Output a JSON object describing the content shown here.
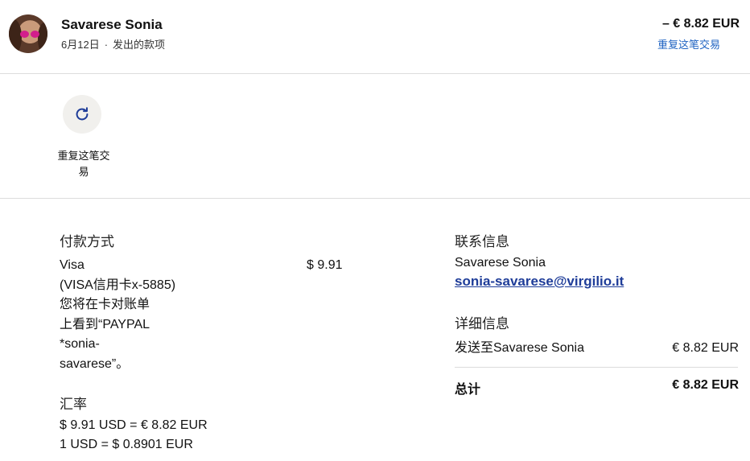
{
  "header": {
    "payee_name": "Savarese Sonia",
    "date": "6月12日",
    "separator": "·",
    "type": "发出的款项",
    "amount": "– € 8.82 EUR",
    "repeat_link": "重复这笔交易"
  },
  "actions": {
    "repeat_label": "重复这笔交易"
  },
  "payment_method": {
    "title": "付款方式",
    "description": "Visa\n(VISA信用卡x-5885)\n您将在卡对账单\n上看到“PAYPAL\n*sonia-\nsavarese”。",
    "amount": "$ 9.91"
  },
  "exchange_rate": {
    "title": "汇率",
    "line1": "$ 9.91 USD = € 8.82 EUR",
    "line2": "1 USD = $ 0.8901 EUR"
  },
  "contact": {
    "title": "联系信息",
    "name": "Savarese Sonia",
    "email": "sonia-savarese@virgilio.it"
  },
  "details": {
    "title": "详细信息",
    "sent_to": "发送至Savarese Sonia",
    "sent_amount": "€ 8.82 EUR",
    "total_label": "总计",
    "total_amount": "€ 8.82 EUR"
  },
  "colors": {
    "link": "#1f63c2",
    "email": "#1f3d99",
    "icon": "#1f3d99"
  },
  "icons": {
    "avatar": "avatar",
    "repeat": "refresh-icon"
  }
}
